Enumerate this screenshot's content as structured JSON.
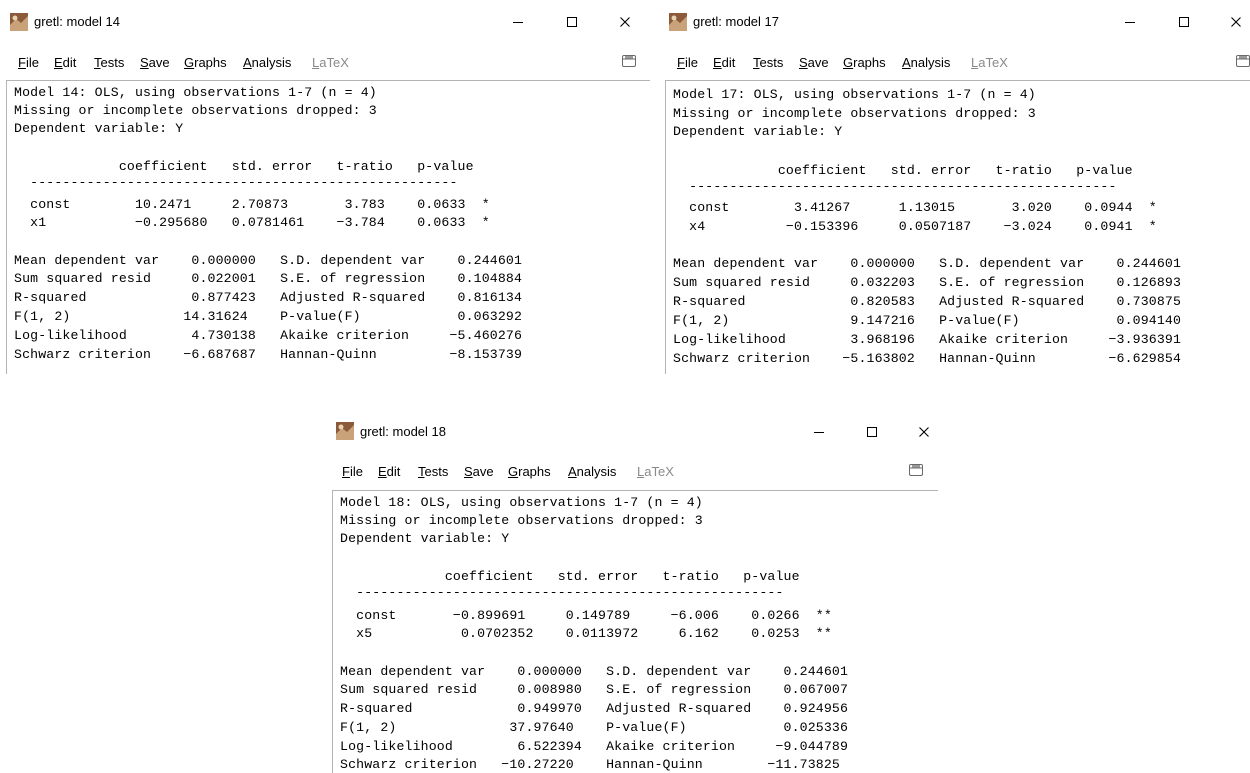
{
  "menus": [
    {
      "label": "File",
      "ul": "F",
      "rest": "ile",
      "disabled": false
    },
    {
      "label": "Edit",
      "ul": "E",
      "rest": "dit",
      "disabled": false
    },
    {
      "label": "Tests",
      "ul": "T",
      "rest": "ests",
      "disabled": false
    },
    {
      "label": "Save",
      "ul": "S",
      "rest": "ave",
      "disabled": false
    },
    {
      "label": "Graphs",
      "ul": "G",
      "rest": "raphs",
      "disabled": false
    },
    {
      "label": "Analysis",
      "ul": "A",
      "rest": "nalysis",
      "disabled": false
    },
    {
      "label": "LaTeX",
      "ul": "L",
      "rest": "aTeX",
      "disabled": true
    }
  ],
  "windows": [
    {
      "title": "gretl: model 14",
      "lines": [
        "Model 14: OLS, using observations 1-7 (n = 4)",
        "Missing or incomplete observations dropped: 3",
        "Dependent variable: Y",
        "",
        "             coefficient   std. error   t-ratio   p-value",
        "  -----------------------------------------------------",
        "  const        10.2471     2.70873       3.783    0.0633  *",
        "  x1           −0.295680   0.0781461    −3.784    0.0633  *",
        "",
        "Mean dependent var    0.000000   S.D. dependent var    0.244601",
        "Sum squared resid     0.022001   S.E. of regression    0.104884",
        "R-squared             0.877423   Adjusted R-squared    0.816134",
        "F(1, 2)              14.31624    P-value(F)            0.063292",
        "Log-likelihood        4.730138   Akaike criterion     −5.460276",
        "Schwarz criterion    −6.687687   Hannan-Quinn         −8.153739"
      ]
    },
    {
      "title": "gretl: model 17",
      "lines": [
        "Model 17: OLS, using observations 1-7 (n = 4)",
        "Missing or incomplete observations dropped: 3",
        "Dependent variable: Y",
        "",
        "             coefficient   std. error   t-ratio   p-value",
        "  -----------------------------------------------------",
        "  const        3.41267      1.13015       3.020    0.0944  *",
        "  x4          −0.153396     0.0507187    −3.024    0.0941  *",
        "",
        "Mean dependent var    0.000000   S.D. dependent var    0.244601",
        "Sum squared resid     0.032203   S.E. of regression    0.126893",
        "R-squared             0.820583   Adjusted R-squared    0.730875",
        "F(1, 2)               9.147216   P-value(F)            0.094140",
        "Log-likelihood        3.968196   Akaike criterion     −3.936391",
        "Schwarz criterion    −5.163802   Hannan-Quinn         −6.629854"
      ]
    },
    {
      "title": "gretl: model 18",
      "lines": [
        "Model 18: OLS, using observations 1-7 (n = 4)",
        "Missing or incomplete observations dropped: 3",
        "Dependent variable: Y",
        "",
        "             coefficient   std. error   t-ratio   p-value",
        "  -----------------------------------------------------",
        "  const       −0.899691     0.149789     −6.006    0.0266  **",
        "  x5           0.0702352    0.0113972     6.162    0.0253  **",
        "",
        "Mean dependent var    0.000000   S.D. dependent var    0.244601",
        "Sum squared resid     0.008980   S.E. of regression    0.067007",
        "R-squared             0.949970   Adjusted R-squared    0.924956",
        "F(1, 2)              37.97640    P-value(F)            0.025336",
        "Log-likelihood        6.522394   Akaike criterion     −9.044789",
        "Schwarz criterion   −10.27220    Hannan-Quinn        −11.73825"
      ]
    }
  ]
}
